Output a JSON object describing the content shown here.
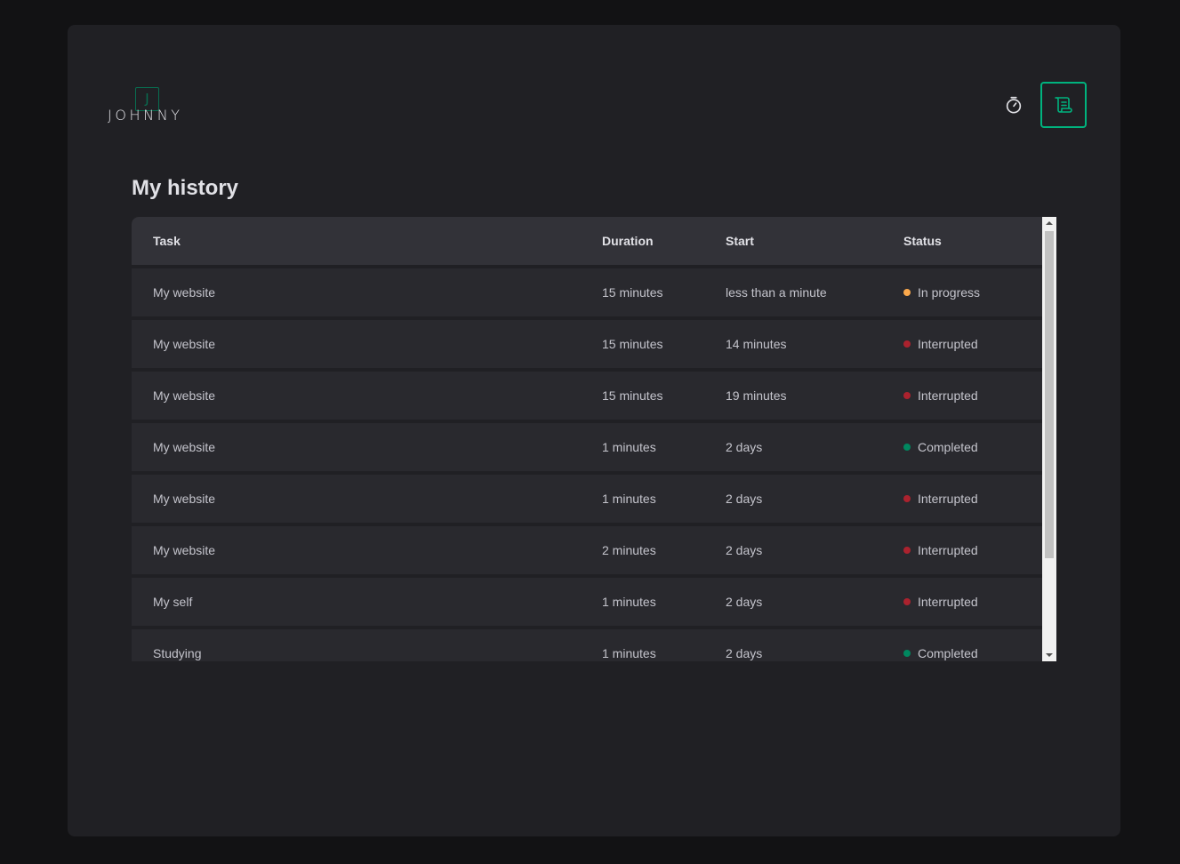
{
  "header": {
    "logo_letter": "J",
    "logo_text": "JOHNNY",
    "nav": [
      {
        "icon": "timer-icon",
        "active": false
      },
      {
        "icon": "scroll-icon",
        "active": true
      }
    ]
  },
  "page": {
    "title": "My history"
  },
  "table": {
    "columns": [
      "Task",
      "Duration",
      "Start",
      "Status"
    ],
    "rows": [
      {
        "task": "My website",
        "duration": "15 minutes",
        "start": "less than a minute",
        "status": "In progress",
        "status_color": "#fba94c"
      },
      {
        "task": "My website",
        "duration": "15 minutes",
        "start": "14 minutes",
        "status": "Interrupted",
        "status_color": "#ab222e"
      },
      {
        "task": "My website",
        "duration": "15 minutes",
        "start": "19 minutes",
        "status": "Interrupted",
        "status_color": "#ab222e"
      },
      {
        "task": "My website",
        "duration": "1 minutes",
        "start": "2 days",
        "status": "Completed",
        "status_color": "#00875f"
      },
      {
        "task": "My website",
        "duration": "1 minutes",
        "start": "2 days",
        "status": "Interrupted",
        "status_color": "#ab222e"
      },
      {
        "task": "My website",
        "duration": "2 minutes",
        "start": "2 days",
        "status": "Interrupted",
        "status_color": "#ab222e"
      },
      {
        "task": "My self",
        "duration": "1 minutes",
        "start": "2 days",
        "status": "Interrupted",
        "status_color": "#ab222e"
      },
      {
        "task": "Studying",
        "duration": "1 minutes",
        "start": "2 days",
        "status": "Completed",
        "status_color": "#00875f"
      }
    ]
  },
  "colors": {
    "accent": "#00b37e",
    "accent_dark": "#00875f",
    "in_progress": "#fba94c",
    "interrupted": "#ab222e",
    "completed": "#00875f"
  }
}
